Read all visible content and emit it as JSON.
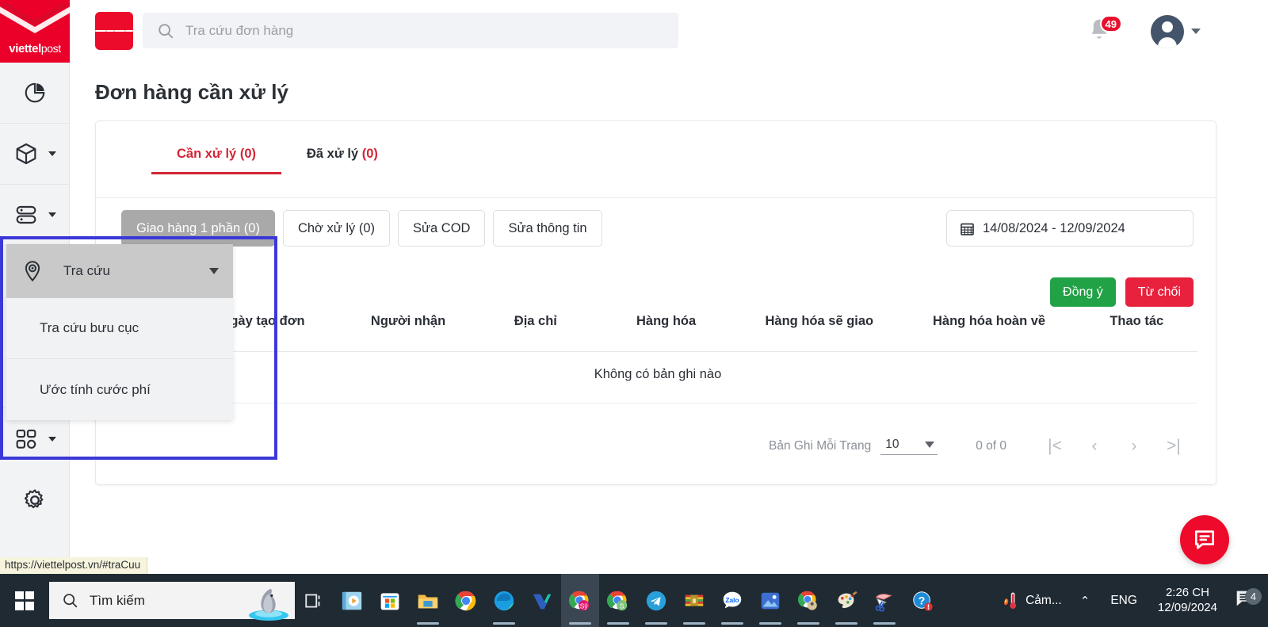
{
  "brand": {
    "name": "viettel",
    "suffix": "post",
    "red": "#ea0029"
  },
  "topbar": {
    "search_placeholder": "Tra cứu đơn hàng",
    "notification_count": "49"
  },
  "sidebar": {
    "items": [
      {
        "icon": "chart-pie-icon",
        "label": ""
      },
      {
        "icon": "box-icon",
        "label": "",
        "has_caret": true
      },
      {
        "icon": "server-stack-icon",
        "label": "",
        "has_caret": true
      },
      {
        "icon": "grid-apps-icon",
        "label": "",
        "has_caret": true
      },
      {
        "icon": "gear-icon",
        "label": ""
      }
    ]
  },
  "flyout": {
    "header_label": "Tra cứu",
    "header_icon": "map-pin-icon",
    "items": [
      {
        "label": "Tra cứu bưu cục"
      },
      {
        "label": "Ước tính cước phí"
      }
    ]
  },
  "page": {
    "title": "Đơn hàng cần xử lý"
  },
  "tabs": [
    {
      "label": "Cần xử lý",
      "count": "(0)",
      "active": true
    },
    {
      "label": "Đã xử lý",
      "count": "(0)",
      "active": false
    }
  ],
  "filter_pills": [
    {
      "label": "Giao hàng 1 phần (0)",
      "selected": true
    },
    {
      "label": "Chờ xử lý (0)",
      "selected": false
    },
    {
      "label": "Sửa COD",
      "selected": false
    },
    {
      "label": "Sửa thông tin",
      "selected": false
    }
  ],
  "date_range": {
    "value": "14/08/2024 - 12/09/2024",
    "icon": "calendar-icon"
  },
  "actions": {
    "approve_label": "Đồng ý",
    "reject_label": "Từ chối",
    "approve_color": "#22a247",
    "reject_color": "#e8213d"
  },
  "table": {
    "columns": [
      "Ngày tạo đơn",
      "Người nhận",
      "Địa chỉ",
      "Hàng hóa",
      "Hàng hóa sẽ giao",
      "Hàng hóa hoàn về",
      "Thao tác"
    ],
    "empty_message": "Không có bản ghi nào"
  },
  "pagination": {
    "rows_label": "Bản Ghi Mỗi Trang",
    "rows_value": "10",
    "range_text": "0 of 0",
    "first_icon": "|<",
    "prev_icon": "‹",
    "next_icon": "›",
    "last_icon": ">|"
  },
  "fab": {
    "icon": "chat-bubble-icon"
  },
  "status_url": "https://viettelpost.vn/#traCuu",
  "taskbar": {
    "start_icon": "windows-logo-icon",
    "search_placeholder": "Tìm kiếm",
    "search_icon": "search-icon",
    "task_view_icon": "task-view-icon",
    "apps": [
      {
        "name": "media-player-icon"
      },
      {
        "name": "microsoft-store-icon"
      },
      {
        "name": "file-explorer-icon"
      },
      {
        "name": "google-chrome-icon"
      },
      {
        "name": "microsoft-edge-icon"
      },
      {
        "name": "unikey-icon"
      },
      {
        "name": "chrome-sy-icon",
        "active": true
      },
      {
        "name": "chrome-s-icon"
      },
      {
        "name": "telegram-icon"
      },
      {
        "name": "winrar-icon"
      },
      {
        "name": "zalo-icon"
      },
      {
        "name": "photos-icon"
      },
      {
        "name": "chrome-profile-icon"
      },
      {
        "name": "paint-icon"
      },
      {
        "name": "snipping-tool-icon"
      },
      {
        "name": "help-icon"
      }
    ],
    "tray": {
      "weather_icon": "thermometer-icon",
      "weather_text": "Cảm...",
      "chevron_icon": "chevron-up-icon",
      "language": "ENG",
      "time": "2:26 CH",
      "date": "12/09/2024",
      "notification_icon": "notification-icon",
      "notification_count": "4"
    }
  }
}
